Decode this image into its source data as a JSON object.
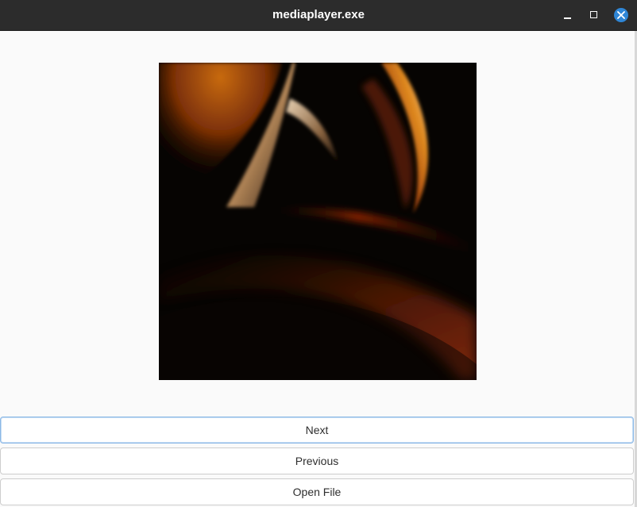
{
  "window": {
    "title": "mediaplayer.exe"
  },
  "artwork": {
    "description_icon": "abstract-wallpaper-image"
  },
  "buttons": {
    "next": "Next",
    "previous": "Previous",
    "open_file": "Open File"
  },
  "colors": {
    "titlebar": "#2c2c2c",
    "close_accent": "#2f86d6",
    "focus_border": "#8bb8e6",
    "background": "#fafafa"
  }
}
